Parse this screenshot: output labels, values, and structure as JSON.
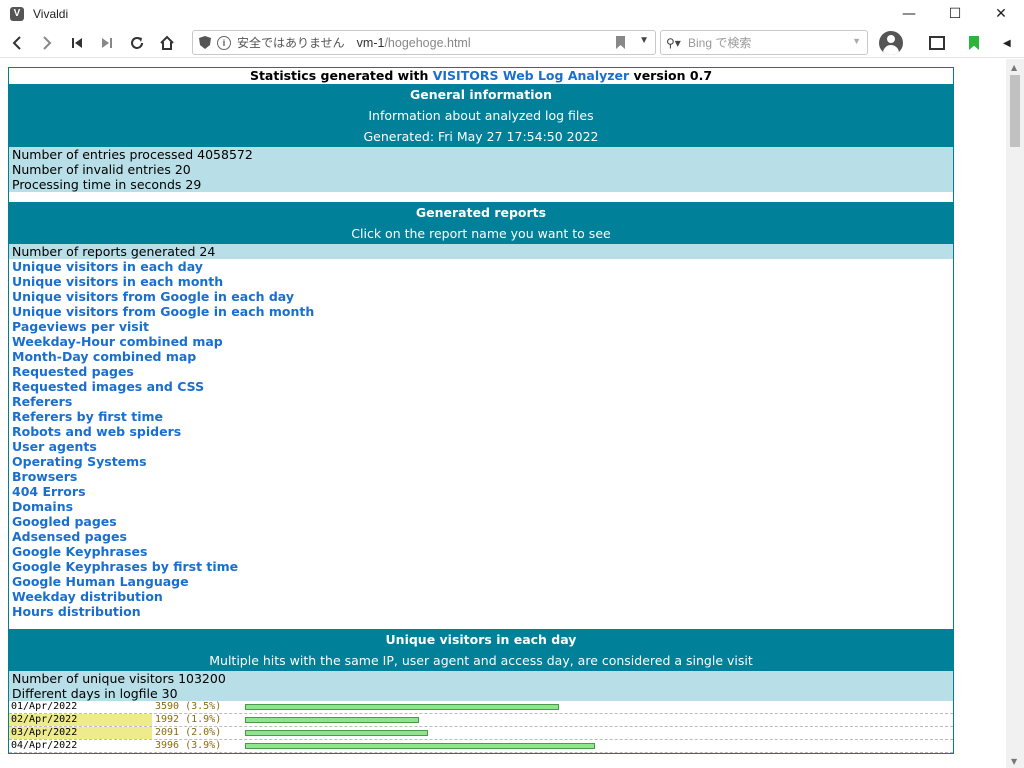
{
  "window": {
    "title": "Vivaldi",
    "icon_letter": "V",
    "minimize": "—",
    "maximize": "☐",
    "close": "✕"
  },
  "toolbar": {
    "url_insecure_label": "安全ではありません",
    "url_host": "vm-1",
    "url_path": "/hogehoge.html",
    "search_placeholder": "Bing で検索"
  },
  "page": {
    "title_prefix": "Statistics generated with ",
    "title_link": "VISITORS Web Log Analyzer",
    "title_suffix": " version 0.7",
    "general": {
      "title": "General information",
      "subtitle": "Information about analyzed log files",
      "generated": "Generated: Fri May 27 17:54:50 2022",
      "lines": [
        "Number of entries processed 4058572",
        "Number of invalid entries 20",
        "Processing time in seconds 29"
      ]
    },
    "reports": {
      "title": "Generated reports",
      "subtitle": "Click on the report name you want to see",
      "count": "Number of reports generated 24",
      "items": [
        "Unique visitors in each day",
        "Unique visitors in each month",
        "Unique visitors from Google in each day",
        "Unique visitors from Google in each month",
        "Pageviews per visit",
        "Weekday-Hour combined map",
        "Month-Day combined map",
        "Requested pages",
        "Requested images and CSS",
        "Referers",
        "Referers by first time",
        "Robots and web spiders",
        "User agents",
        "Operating Systems",
        "Browsers",
        "404 Errors",
        "Domains",
        "Googled pages",
        "Adsensed pages",
        "Google Keyphrases",
        "Google Keyphrases by first time",
        "Google Human Language",
        "Weekday distribution",
        "Hours distribution"
      ]
    },
    "daily": {
      "title": "Unique visitors in each day",
      "subtitle": "Multiple hits with the same IP, user agent and access day, are considered a single visit",
      "lines": [
        "Number of unique visitors 103200",
        "Different days in logfile 30"
      ],
      "rows": [
        {
          "date": "01/Apr/2022",
          "value": "3590 (3.5%)",
          "highlight": false,
          "ratio": 0.8984
        },
        {
          "date": "02/Apr/2022",
          "value": "1992 (1.9%)",
          "highlight": true,
          "ratio": 0.4985
        },
        {
          "date": "03/Apr/2022",
          "value": "2091 (2.0%)",
          "highlight": true,
          "ratio": 0.5233
        },
        {
          "date": "04/Apr/2022",
          "value": "3996 (3.9%)",
          "highlight": false,
          "ratio": 1.0
        }
      ]
    }
  }
}
